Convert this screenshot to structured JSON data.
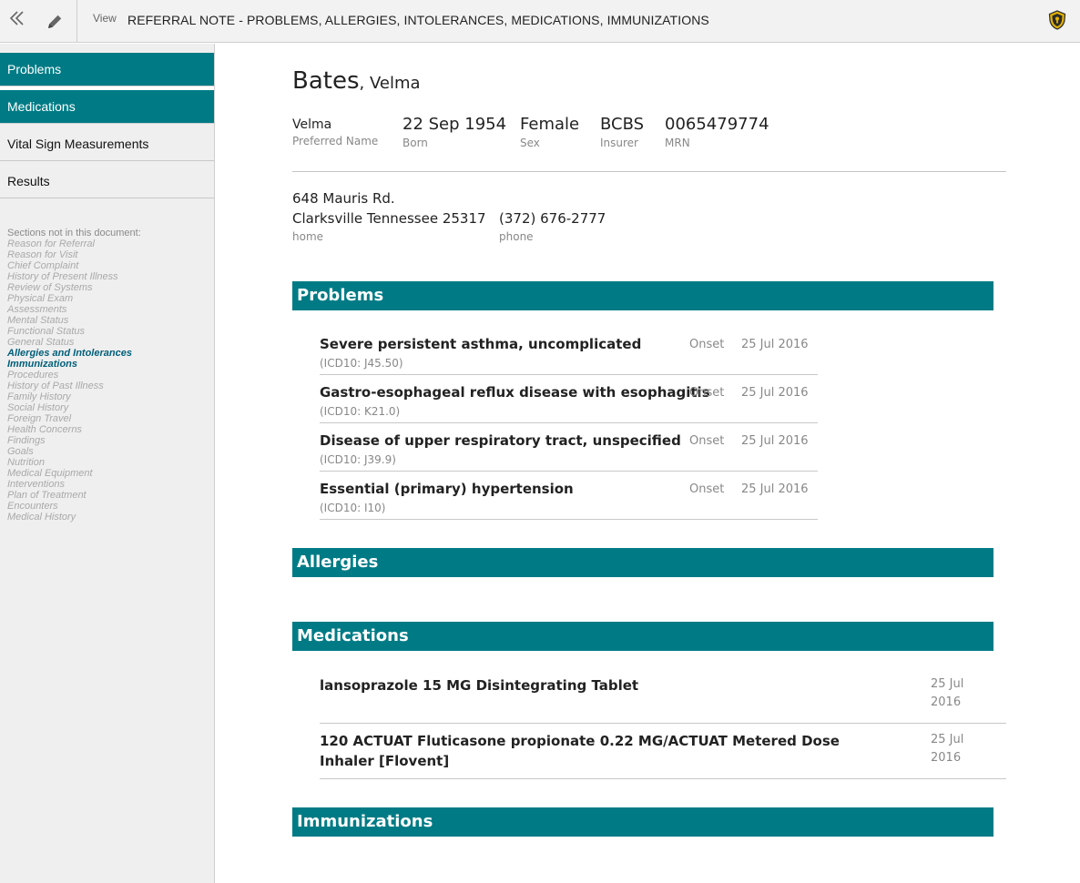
{
  "toolbar": {
    "view_label": "View",
    "title": "REFERRAL NOTE - PROBLEMS, ALLERGIES, INTOLERANCES, MEDICATIONS, IMMUNIZATIONS",
    "back_icon": "double-chevron-left-icon",
    "edit_icon": "pencil-icon",
    "shield_icon": "shield-icon"
  },
  "sidebar": {
    "items": [
      {
        "label": "Problems",
        "active": true
      },
      {
        "label": "Medications",
        "active": true
      },
      {
        "label": "Vital Sign Measurements",
        "active": false
      },
      {
        "label": "Results",
        "active": false
      }
    ],
    "missing_heading": "Sections not in this document:",
    "missing_sections": [
      "Reason for Referral",
      "Reason for Visit",
      "Chief Complaint",
      "History of Present Illness",
      "Review of Systems",
      "Physical Exam",
      "Assessments",
      "Mental Status",
      "Functional Status",
      "General Status",
      "Allergies and Intolerances",
      "Immunizations",
      "Procedures",
      "History of Past Illness",
      "Family History",
      "Social History",
      "Foreign Travel",
      "Health Concerns",
      "Findings",
      "Goals",
      "Nutrition",
      "Medical Equipment",
      "Interventions",
      "Plan of Treatment",
      "Encounters",
      "Medical History"
    ],
    "present_sections": [
      "Allergies and Intolerances",
      "Immunizations"
    ]
  },
  "patient": {
    "last_name": "Bates",
    "first_name": ", Velma",
    "preferred_name": {
      "value": "Velma",
      "label": "Preferred Name"
    },
    "born": {
      "value": "22 Sep 1954",
      "label": "Born"
    },
    "sex": {
      "value": "Female",
      "label": "Sex"
    },
    "insurer": {
      "value": "BCBS",
      "label": "Insurer"
    },
    "mrn": {
      "value": "0065479774",
      "label": "MRN"
    },
    "address_line1": "648 Mauris Rd.",
    "address_line2": "Clarksville Tennessee 25317",
    "address_label": "home",
    "phone": "(372) 676-2777",
    "phone_label": "phone"
  },
  "sections": {
    "problems": "Problems",
    "allergies": "Allergies",
    "medications": "Medications",
    "immunizations": "Immunizations"
  },
  "problems": [
    {
      "title": "Severe persistent asthma, uncomplicated",
      "code": "(ICD10: J45.50)",
      "onset_label": "Onset",
      "onset_date": "25 Jul 2016"
    },
    {
      "title": "Gastro-esophageal reflux disease with esophagitis",
      "code": "(ICD10: K21.0)",
      "onset_label": "Onset",
      "onset_date": "25 Jul 2016"
    },
    {
      "title": "Disease of upper respiratory tract, unspecified",
      "code": "(ICD10: J39.9)",
      "onset_label": "Onset",
      "onset_date": "25 Jul 2016"
    },
    {
      "title": "Essential (primary) hypertension",
      "code": "(ICD10: I10)",
      "onset_label": "Onset",
      "onset_date": "25 Jul 2016"
    }
  ],
  "medications": [
    {
      "title": "lansoprazole 15 MG Disintegrating Tablet",
      "date": "25 Jul 2016"
    },
    {
      "title": "120 ACTUAT Fluticasone propionate 0.22 MG/ACTUAT Metered Dose Inhaler [Flovent]",
      "date": "25 Jul 2016"
    }
  ],
  "colors": {
    "accent": "#007b85",
    "sidebar_bg": "#efefef",
    "present_section": "#005f7a",
    "missing_section": "#a9a9a9",
    "shield": "#e8b400"
  }
}
